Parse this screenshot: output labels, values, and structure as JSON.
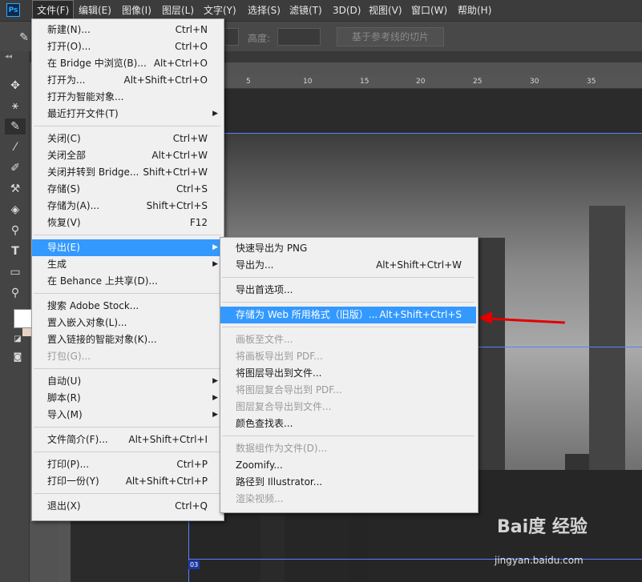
{
  "app": {
    "logo": "Ps"
  },
  "menubar": [
    {
      "label": "文件(F)",
      "active": true
    },
    {
      "label": "编辑(E)"
    },
    {
      "label": "图像(I)"
    },
    {
      "label": "图层(L)"
    },
    {
      "label": "文字(Y)"
    },
    {
      "label": "选择(S)"
    },
    {
      "label": "滤镜(T)"
    },
    {
      "label": "3D(D)"
    },
    {
      "label": "视图(V)"
    },
    {
      "label": "窗口(W)"
    },
    {
      "label": "帮助(H)"
    }
  ],
  "options": {
    "height_label": "高度:",
    "slice_button": "基于参考线的切片"
  },
  "ruler": {
    "h_ticks": [
      "5",
      "10",
      "15",
      "20",
      "25",
      "30",
      "35"
    ]
  },
  "file_menu": [
    {
      "label": "新建(N)...",
      "shortcut": "Ctrl+N"
    },
    {
      "label": "打开(O)...",
      "shortcut": "Ctrl+O"
    },
    {
      "label": "在 Bridge 中浏览(B)...",
      "shortcut": "Alt+Ctrl+O"
    },
    {
      "label": "打开为...",
      "shortcut": "Alt+Shift+Ctrl+O"
    },
    {
      "label": "打开为智能对象..."
    },
    {
      "label": "最近打开文件(T)",
      "submenu": true
    },
    {
      "sep": true
    },
    {
      "label": "关闭(C)",
      "shortcut": "Ctrl+W"
    },
    {
      "label": "关闭全部",
      "shortcut": "Alt+Ctrl+W"
    },
    {
      "label": "关闭并转到 Bridge...",
      "shortcut": "Shift+Ctrl+W"
    },
    {
      "label": "存储(S)",
      "shortcut": "Ctrl+S"
    },
    {
      "label": "存储为(A)...",
      "shortcut": "Shift+Ctrl+S"
    },
    {
      "label": "恢复(V)",
      "shortcut": "F12"
    },
    {
      "sep": true
    },
    {
      "label": "导出(E)",
      "submenu": true,
      "highlighted": true
    },
    {
      "label": "生成",
      "submenu": true
    },
    {
      "label": "在 Behance 上共享(D)..."
    },
    {
      "sep": true
    },
    {
      "label": "搜索 Adobe Stock..."
    },
    {
      "label": "置入嵌入对象(L)..."
    },
    {
      "label": "置入链接的智能对象(K)..."
    },
    {
      "label": "打包(G)...",
      "disabled": true
    },
    {
      "sep": true
    },
    {
      "label": "自动(U)",
      "submenu": true
    },
    {
      "label": "脚本(R)",
      "submenu": true
    },
    {
      "label": "导入(M)",
      "submenu": true
    },
    {
      "sep": true
    },
    {
      "label": "文件简介(F)...",
      "shortcut": "Alt+Shift+Ctrl+I"
    },
    {
      "sep": true
    },
    {
      "label": "打印(P)...",
      "shortcut": "Ctrl+P"
    },
    {
      "label": "打印一份(Y)",
      "shortcut": "Alt+Shift+Ctrl+P"
    },
    {
      "sep": true
    },
    {
      "label": "退出(X)",
      "shortcut": "Ctrl+Q"
    }
  ],
  "export_menu": [
    {
      "label": "快速导出为 PNG"
    },
    {
      "label": "导出为...",
      "shortcut": "Alt+Shift+Ctrl+W"
    },
    {
      "sep": true
    },
    {
      "label": "导出首选项..."
    },
    {
      "sep": true
    },
    {
      "label": "存储为 Web 所用格式（旧版）...",
      "shortcut": "Alt+Shift+Ctrl+S",
      "highlighted": true
    },
    {
      "sep": true
    },
    {
      "label": "画板至文件...",
      "disabled": true
    },
    {
      "label": "将画板导出到 PDF...",
      "disabled": true
    },
    {
      "label": "将图层导出到文件..."
    },
    {
      "label": "将图层复合导出到 PDF...",
      "disabled": true
    },
    {
      "label": "图层复合导出到文件...",
      "disabled": true
    },
    {
      "label": "颜色查找表..."
    },
    {
      "sep": true
    },
    {
      "label": "数据组作为文件(D)...",
      "disabled": true
    },
    {
      "label": "Zoomify..."
    },
    {
      "label": "路径到 Illustrator..."
    },
    {
      "label": "渲染视频...",
      "disabled": true
    }
  ],
  "canvas": {
    "layer_tag": "03"
  },
  "watermark": {
    "brand": "Bai度 经验",
    "url": "jingyan.baidu.com"
  },
  "colors": {
    "highlight": "#3399ff",
    "arrow": "#e10000",
    "guide": "#5b7fff"
  }
}
